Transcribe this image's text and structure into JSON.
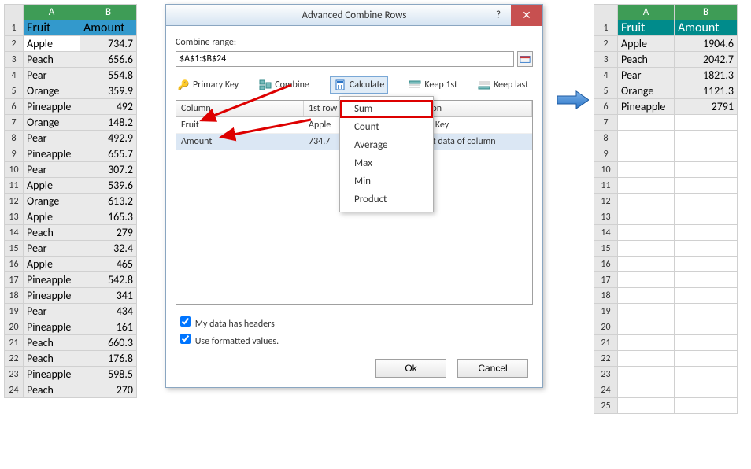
{
  "left_grid": {
    "headers": {
      "A": "Fruit",
      "B": "Amount"
    },
    "rows": [
      [
        "Apple",
        "734.7"
      ],
      [
        "Peach",
        "656.6"
      ],
      [
        "Pear",
        "554.8"
      ],
      [
        "Orange",
        "359.9"
      ],
      [
        "Pineapple",
        "492"
      ],
      [
        "Orange",
        "148.2"
      ],
      [
        "Pear",
        "492.9"
      ],
      [
        "Pineapple",
        "655.7"
      ],
      [
        "Pear",
        "307.2"
      ],
      [
        "Apple",
        "539.6"
      ],
      [
        "Orange",
        "613.2"
      ],
      [
        "Apple",
        "165.3"
      ],
      [
        "Peach",
        "279"
      ],
      [
        "Pear",
        "32.4"
      ],
      [
        "Apple",
        "465"
      ],
      [
        "Pineapple",
        "542.8"
      ],
      [
        "Pineapple",
        "341"
      ],
      [
        "Pear",
        "434"
      ],
      [
        "Pineapple",
        "161"
      ],
      [
        "Peach",
        "660.3"
      ],
      [
        "Peach",
        "176.8"
      ],
      [
        "Pineapple",
        "598.5"
      ],
      [
        "Peach",
        "270"
      ]
    ]
  },
  "right_grid": {
    "headers": {
      "A": "Fruit",
      "B": "Amount"
    },
    "rows": [
      [
        "Apple",
        "1904.6"
      ],
      [
        "Peach",
        "2042.7"
      ],
      [
        "Pear",
        "1821.3"
      ],
      [
        "Orange",
        "1121.3"
      ],
      [
        "Pineapple",
        "2791"
      ]
    ],
    "blank_rows": 19
  },
  "dialog": {
    "title": "Advanced Combine Rows",
    "help_glyph": "?",
    "close_glyph": "✕",
    "combine_range_label": "Combine range:",
    "combine_range_value": "$A$1:$B$24",
    "ops": [
      {
        "key": "primary",
        "label": "Primary Key"
      },
      {
        "key": "combine",
        "label": "Combine"
      },
      {
        "key": "calculate",
        "label": "Calculate"
      },
      {
        "key": "keep1st",
        "label": "Keep 1st"
      },
      {
        "key": "keeplast",
        "label": "Keep last"
      }
    ],
    "list": {
      "headers": [
        "Column",
        "1st row",
        "Operation"
      ],
      "rows": [
        [
          "Fruit",
          "Apple",
          "Primary Key"
        ],
        [
          "Amount",
          "734.7",
          "Keep 1st data of column"
        ]
      ]
    },
    "menu": [
      "Sum",
      "Count",
      "Average",
      "Max",
      "Min",
      "Product"
    ],
    "checkbox1": "My data has headers",
    "checkbox2": "Use formatted values.",
    "ok": "Ok",
    "cancel": "Cancel"
  },
  "col_labels": [
    "A",
    "B"
  ]
}
